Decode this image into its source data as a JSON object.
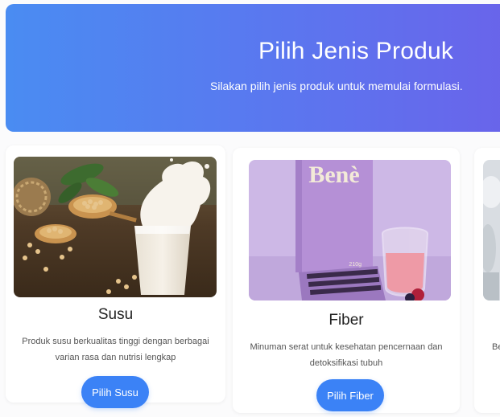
{
  "hero": {
    "title": "Pilih Jenis Produk",
    "subtitle": "Silakan pilih jenis produk untuk memulai formulasi."
  },
  "cards": [
    {
      "title": "Susu",
      "description": "Produk susu berkualitas tinggi dengan berbagai varian rasa dan nutrisi lengkap",
      "button_label": "Pilih Susu",
      "image": "milk-and-soybeans-photo"
    },
    {
      "title": "Fiber",
      "description": "Minuman serat untuk kesehatan pencernaan dan detoksifikasi tubuh",
      "button_label": "Pilih Fiber",
      "image": "bene-fiber-product-photo",
      "image_brand_text": "Benè",
      "image_box_text": "210g"
    },
    {
      "description_partial": "Be",
      "image": "partially-visible-product-photo"
    }
  ],
  "colors": {
    "hero_gradient_start": "#4a8cf2",
    "hero_gradient_end": "#6a63ea",
    "button": "#3b82f6"
  }
}
